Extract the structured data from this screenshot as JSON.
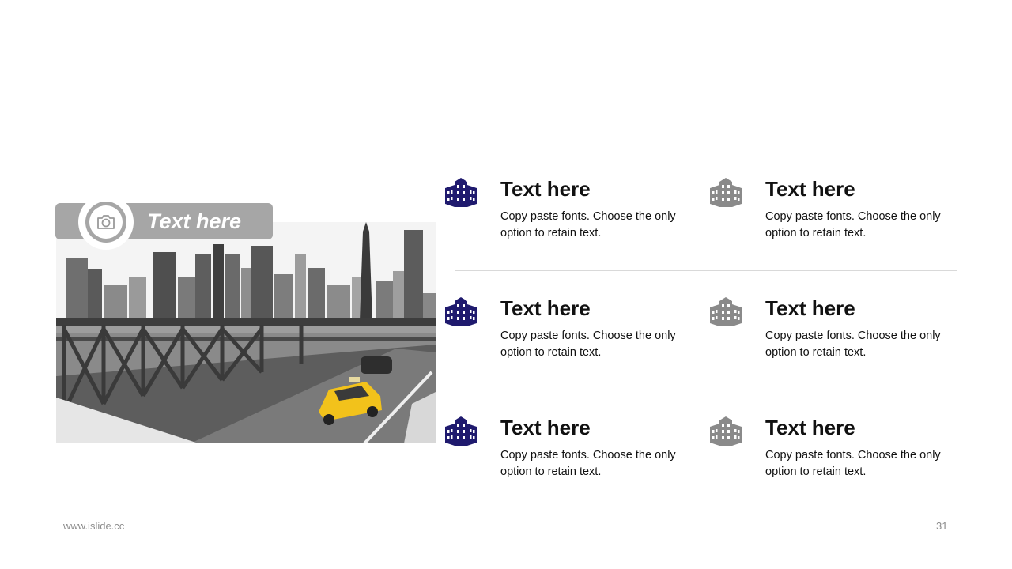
{
  "banner": {
    "label": "Text here"
  },
  "icons": {
    "camera": "camera-icon",
    "building": "building-icon"
  },
  "colors": {
    "accent": "#1f1a6e",
    "muted": "#8a8a8a",
    "banner": "#a6a6a6",
    "taxi": "#f2c21b"
  },
  "grid": [
    {
      "title": "Text here",
      "body": "Copy paste fonts. Choose the only option to retain text."
    },
    {
      "title": "Text here",
      "body": "Copy paste fonts. Choose the only option to retain text."
    },
    {
      "title": "Text here",
      "body": "Copy paste fonts. Choose the only option to retain text."
    },
    {
      "title": "Text here",
      "body": "Copy paste fonts. Choose the only option to retain text."
    },
    {
      "title": "Text here",
      "body": "Copy paste fonts. Choose the only option to retain text."
    },
    {
      "title": "Text here",
      "body": "Copy paste fonts. Choose the only option to retain text."
    }
  ],
  "footer": {
    "url": "www.islide.cc",
    "page": "31"
  }
}
